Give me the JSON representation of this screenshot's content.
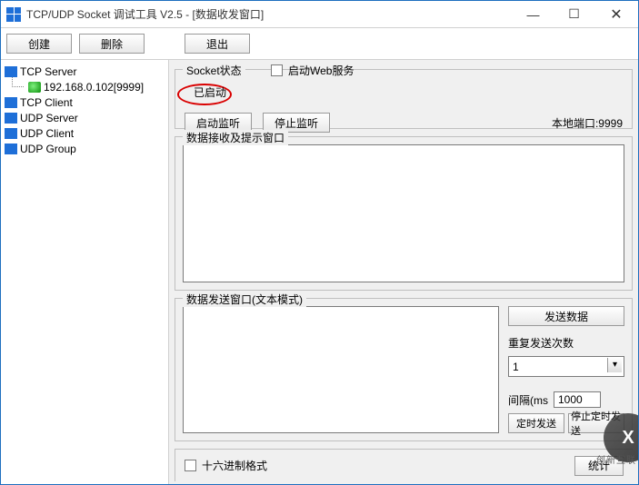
{
  "window": {
    "title": "TCP/UDP Socket 调试工具 V2.5 - [数据收发窗口]"
  },
  "toolbar": {
    "create": "创建",
    "delete": "删除",
    "exit": "退出"
  },
  "tree": {
    "tcp_server": "TCP Server",
    "tcp_server_child": "192.168.0.102[9999]",
    "tcp_client": "TCP Client",
    "udp_server": "UDP Server",
    "udp_client": "UDP Client",
    "udp_group": "UDP Group"
  },
  "status": {
    "legend": "Socket状态",
    "web_checkbox_label": "启动Web服务",
    "started_text": "已启动",
    "start_listen": "启动监听",
    "stop_listen": "停止监听",
    "port_label": "本地端口:9999"
  },
  "recv": {
    "legend": "数据接收及提示窗口"
  },
  "send": {
    "legend": "数据发送窗口(文本模式)",
    "send_btn": "发送数据",
    "repeat_label": "重复发送次数",
    "repeat_value": "1",
    "interval_label": "间隔(ms",
    "interval_value": "1000",
    "timed_send": "定时发送",
    "stop_timed_send": "停止定时发送"
  },
  "hex": {
    "label": "十六进制格式",
    "stats_btn": "统计"
  },
  "watermark": {
    "logo": "X",
    "text": "创新互联"
  }
}
